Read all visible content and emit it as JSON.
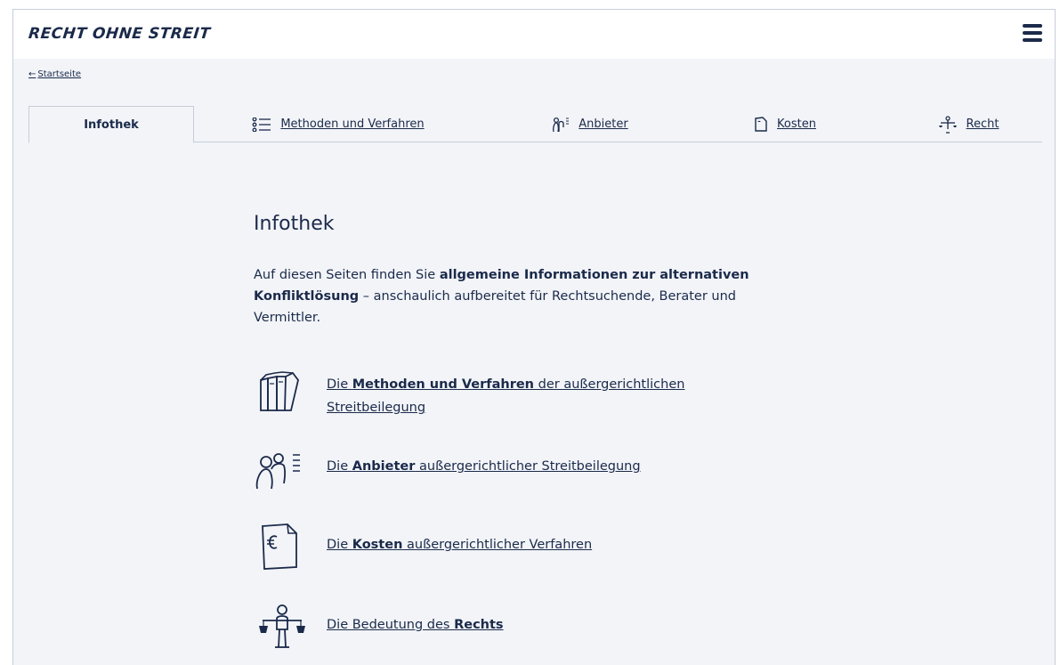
{
  "header": {
    "logo": "RECHT OHNE STREIT",
    "menu_icon": "hamburger-menu-icon"
  },
  "breadcrumb": {
    "arrow": "←",
    "label": "Startseite"
  },
  "tabs": [
    {
      "label": "Infothek",
      "icon": "",
      "active": true
    },
    {
      "label": "Methoden und Verfahren",
      "icon": "list-icon",
      "active": false
    },
    {
      "label": "Anbieter",
      "icon": "people-icon",
      "active": false
    },
    {
      "label": "Kosten",
      "icon": "document-icon",
      "active": false
    },
    {
      "label": "Recht",
      "icon": "scales-icon",
      "active": false
    }
  ],
  "main": {
    "title": "Infothek",
    "intro": {
      "part1": "Auf diesen Seiten finden Sie ",
      "bold1": "allgemeine Informationen zur alternativen Konfliktlösung",
      "part2": " – anschaulich aufbereitet für Rechtsuchende, Berater und Vermittler."
    },
    "links": [
      {
        "pre": "Die ",
        "bold": "Methoden und Verfahren",
        "post": " der außergerichtlichen Streitbeilegung",
        "icon": "books-icon"
      },
      {
        "pre": "Die ",
        "bold": "Anbieter",
        "post": " außergerichtlicher Streitbeilegung",
        "icon": "people-icon"
      },
      {
        "pre": "Die ",
        "bold": "Kosten",
        "post": " außergerichtlicher Verfahren",
        "icon": "euro-document-icon"
      },
      {
        "pre": "Die Bedeutung des ",
        "bold": "Rechts",
        "post": "",
        "icon": "scales-person-icon"
      }
    ]
  },
  "colors": {
    "ink": "#1b2a4a",
    "background": "#f2f4f8",
    "border": "#c7cdd9"
  }
}
